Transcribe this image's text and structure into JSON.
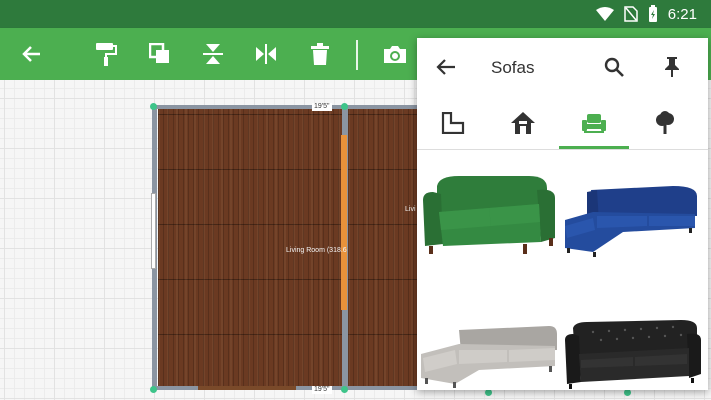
{
  "status_bar": {
    "time": "6:21"
  },
  "toolbar": {
    "buttons": [
      "back",
      "paint-roller",
      "copy",
      "flip-vertical",
      "flip-horizontal",
      "delete",
      "camera"
    ]
  },
  "floorplan": {
    "room_label_left": "Living Room (318.6",
    "room_label_right": "Livi",
    "top_dimension": "19'5\"",
    "bottom_dimension": "19'5\""
  },
  "panel": {
    "title": "Sofas",
    "tabs": [
      "floor-plan",
      "house",
      "sofa",
      "tree"
    ],
    "active_tab": "sofa",
    "items": [
      {
        "name": "green-sofa",
        "color": "#2e7d3a"
      },
      {
        "name": "blue-sectional-sofa",
        "color": "#1f3f8a"
      },
      {
        "name": "gray-sectional-sofa",
        "color": "#b9b6b2"
      },
      {
        "name": "black-leather-sofa",
        "color": "#1e1e1e"
      }
    ]
  },
  "colors": {
    "accent": "#4caf50",
    "status": "#2e7a3c",
    "wall_highlight": "#e8923a",
    "node": "#3ec48a"
  }
}
